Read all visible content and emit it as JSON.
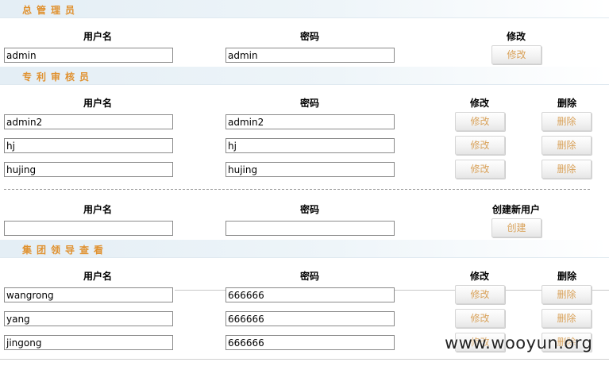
{
  "sections": {
    "admin_title": "总管理员",
    "reviewer_title": "专利审核员",
    "leader_title": "集团领导查看"
  },
  "headers": {
    "username": "用户名",
    "password": "密码",
    "modify": "修改",
    "delete": "删除",
    "create_new_user": "创建新用户"
  },
  "buttons": {
    "modify": "修改",
    "delete": "删除",
    "create": "创建"
  },
  "admin": {
    "username": "admin",
    "password": "admin"
  },
  "reviewers": [
    {
      "username": "admin2",
      "password": "admin2"
    },
    {
      "username": "hj",
      "password": "hj"
    },
    {
      "username": "hujing",
      "password": "hujing"
    }
  ],
  "new_user": {
    "username": "",
    "password": ""
  },
  "leaders": [
    {
      "username": "wangrong",
      "password": "666666"
    },
    {
      "username": "yang",
      "password": "666666"
    },
    {
      "username": "jingong",
      "password": "666666"
    }
  ],
  "watermark": "www.wooyun.org"
}
